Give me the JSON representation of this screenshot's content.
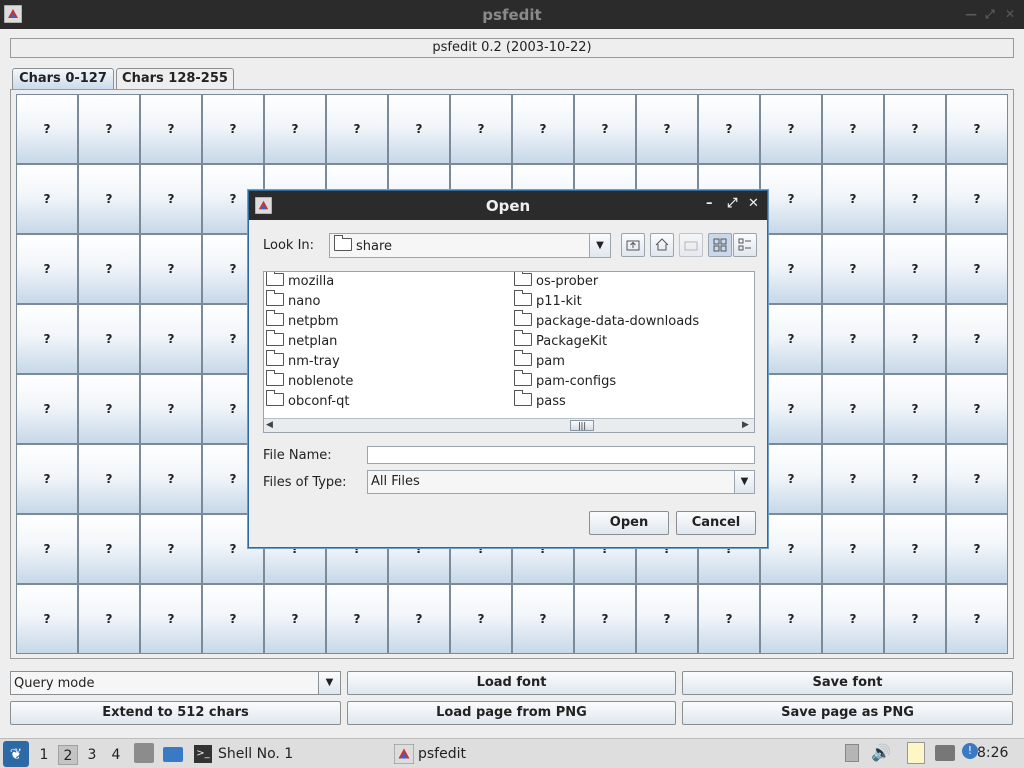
{
  "window": {
    "title": "psfedit"
  },
  "header": {
    "version_label": "psfedit 0.2 (2003-10-22)"
  },
  "tabs": [
    {
      "label": "Chars 0-127"
    },
    {
      "label": "Chars 128-255"
    }
  ],
  "grid": {
    "rows": 8,
    "cols": 16,
    "cell_glyph": "?"
  },
  "controls": {
    "mode_select": {
      "value": "Query mode"
    },
    "load_font": "Load font",
    "save_font": "Save font",
    "extend": "Extend to 512 chars",
    "load_png": "Load page from PNG",
    "save_png": "Save page as PNG"
  },
  "dialog": {
    "title": "Open",
    "look_in_label": "Look In:",
    "look_in_value": "share",
    "files_left": [
      "mozilla",
      "nano",
      "netpbm",
      "netplan",
      "nm-tray",
      "noblenote",
      "obconf-qt"
    ],
    "files_right": [
      "os-prober",
      "p11-kit",
      "package-data-downloads",
      "PackageKit",
      "pam",
      "pam-configs",
      "pass"
    ],
    "file_name_label": "File Name:",
    "file_name_value": "",
    "files_of_type_label": "Files of Type:",
    "files_of_type_value": "All Files",
    "open_button": "Open",
    "cancel_button": "Cancel"
  },
  "taskbar": {
    "desktops": [
      "1",
      "2",
      "3",
      "4"
    ],
    "active_desktop": "2",
    "tasks": [
      {
        "label": "Shell No. 1"
      },
      {
        "label": "psfedit"
      }
    ],
    "clock": "8:26"
  }
}
